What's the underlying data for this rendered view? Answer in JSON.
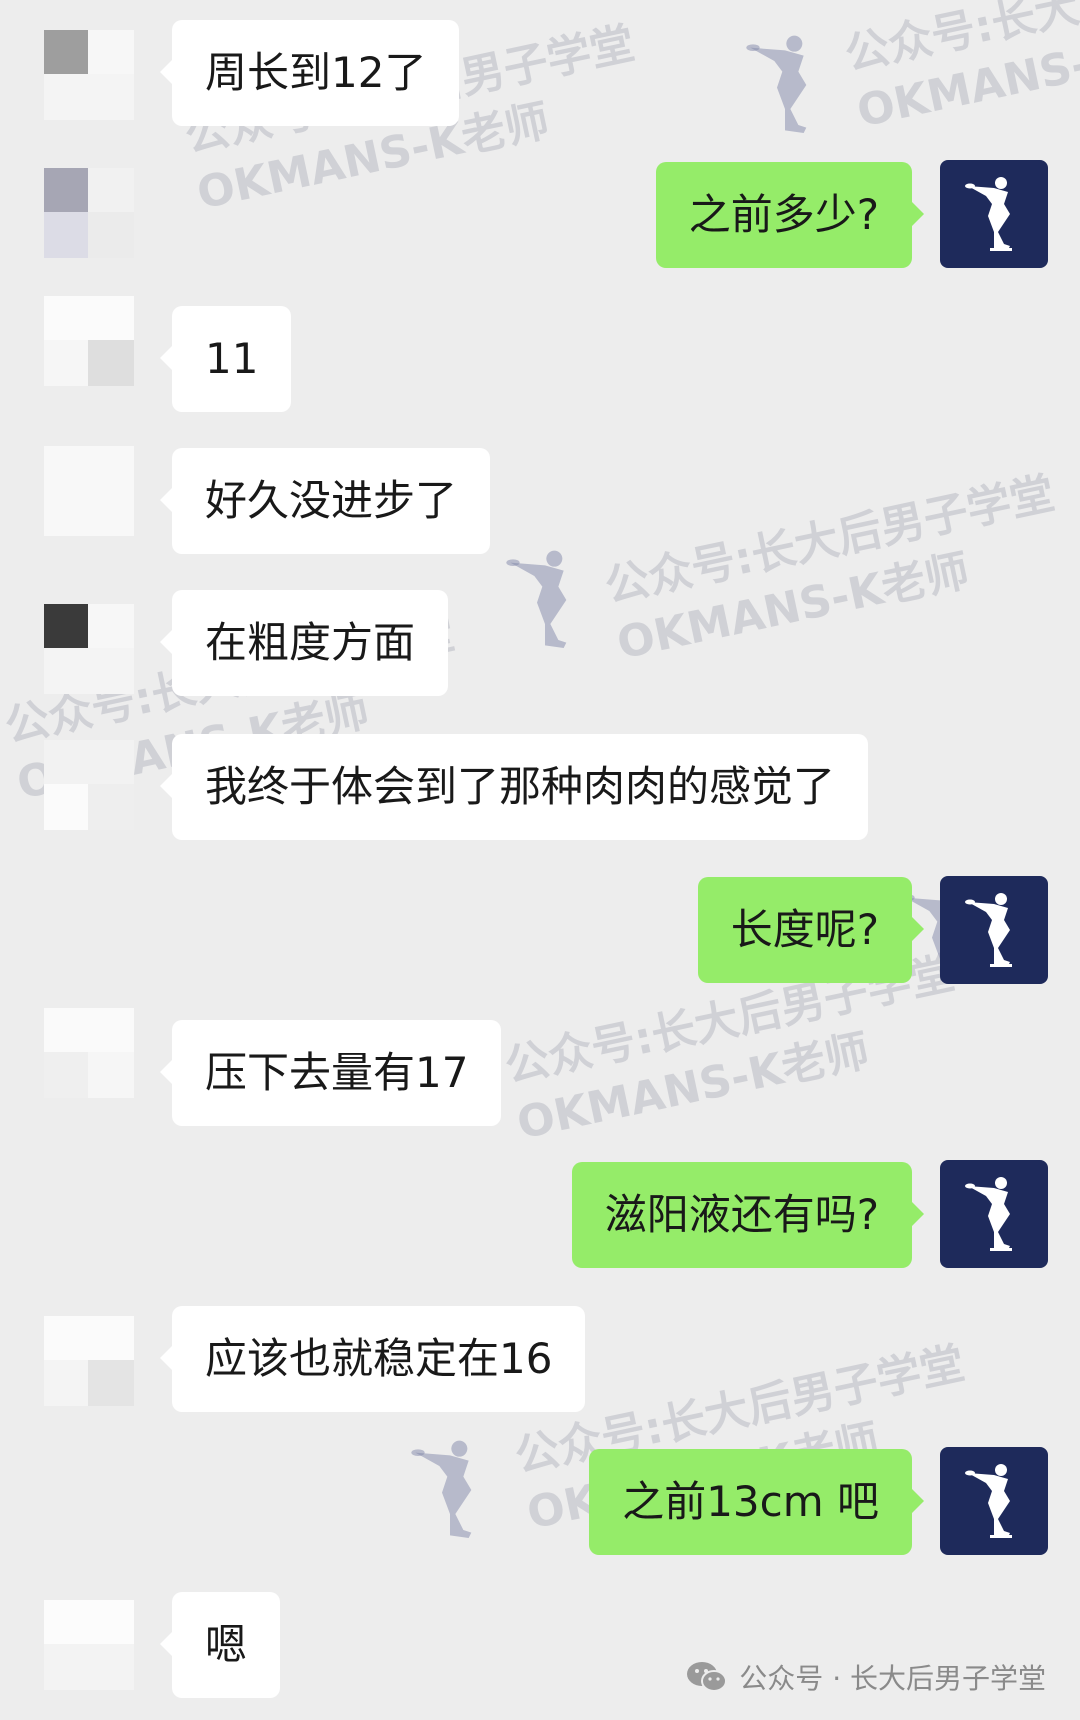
{
  "messages": [
    {
      "side": "left",
      "text": "周长到12了"
    },
    {
      "side": "right",
      "text": "之前多少?"
    },
    {
      "side": "left",
      "text": "11"
    },
    {
      "side": "left",
      "text": "好久没进步了"
    },
    {
      "side": "left",
      "text": "在粗度方面"
    },
    {
      "side": "left",
      "text": "我终于体会到了那种肉肉的感觉了"
    },
    {
      "side": "right",
      "text": "长度呢?"
    },
    {
      "side": "left",
      "text": "压下去量有17"
    },
    {
      "side": "right",
      "text": "滋阳液还有吗?"
    },
    {
      "side": "left",
      "text": "应该也就稳定在16"
    },
    {
      "side": "right",
      "text": "之前13cm 吧"
    },
    {
      "side": "left",
      "text": "嗯"
    }
  ],
  "watermark": {
    "line1": "公众号:长大后男子学堂",
    "line2": "OKMANS-K老师",
    "icon": "discus-thrower-icon",
    "color": "#a5a8b4"
  },
  "self_avatar": {
    "icon": "discus-thrower-icon",
    "bg": "#1e2a5b"
  },
  "footer": {
    "icon": "wechat-icon",
    "text": "公众号 · 长大后男子学堂"
  },
  "colors": {
    "background": "#ededed",
    "left_bubble": "#ffffff",
    "right_bubble": "#95ec69"
  }
}
